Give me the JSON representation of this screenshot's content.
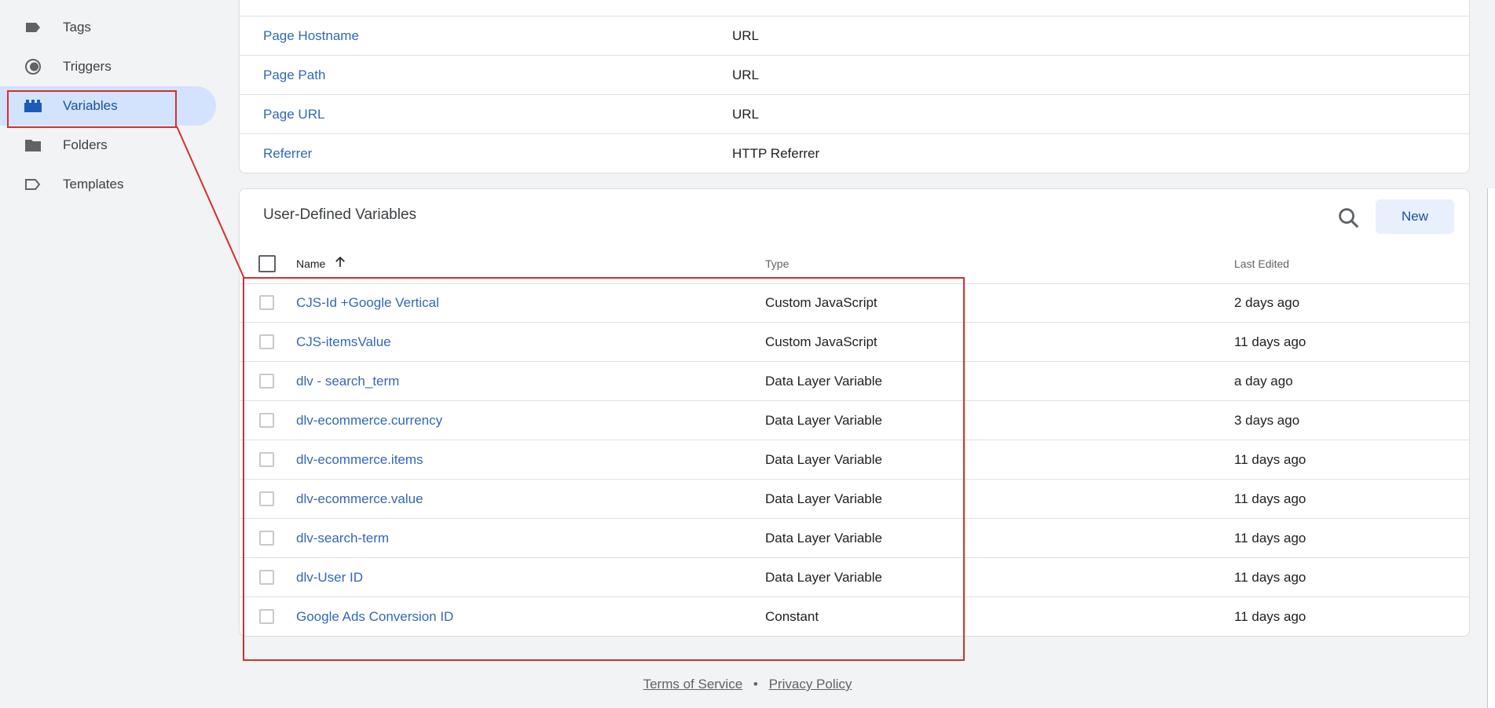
{
  "sidebar": {
    "items": [
      {
        "label": "Tags",
        "icon": "tag-icon"
      },
      {
        "label": "Triggers",
        "icon": "trigger-icon"
      },
      {
        "label": "Variables",
        "icon": "variables-icon",
        "active": true
      },
      {
        "label": "Folders",
        "icon": "folder-icon"
      },
      {
        "label": "Templates",
        "icon": "template-icon"
      }
    ]
  },
  "builtin": {
    "rows": [
      {
        "name": "Page Hostname",
        "type": "URL"
      },
      {
        "name": "Page Path",
        "type": "URL"
      },
      {
        "name": "Page URL",
        "type": "URL"
      },
      {
        "name": "Referrer",
        "type": "HTTP Referrer"
      }
    ]
  },
  "user_defined": {
    "title": "User-Defined Variables",
    "new_label": "New",
    "columns": {
      "name": "Name",
      "type": "Type",
      "last_edited": "Last Edited"
    },
    "rows": [
      {
        "name": "CJS-Id +Google Vertical",
        "type": "Custom JavaScript",
        "last_edited": "2 days ago"
      },
      {
        "name": "CJS-itemsValue",
        "type": "Custom JavaScript",
        "last_edited": "11 days ago"
      },
      {
        "name": "dlv - search_term",
        "type": "Data Layer Variable",
        "last_edited": "a day ago"
      },
      {
        "name": "dlv-ecommerce.currency",
        "type": "Data Layer Variable",
        "last_edited": "3 days ago"
      },
      {
        "name": "dlv-ecommerce.items",
        "type": "Data Layer Variable",
        "last_edited": "11 days ago"
      },
      {
        "name": "dlv-ecommerce.value",
        "type": "Data Layer Variable",
        "last_edited": "11 days ago"
      },
      {
        "name": "dlv-search-term",
        "type": "Data Layer Variable",
        "last_edited": "11 days ago"
      },
      {
        "name": "dlv-User ID",
        "type": "Data Layer Variable",
        "last_edited": "11 days ago"
      },
      {
        "name": "Google Ads Conversion ID",
        "type": "Constant",
        "last_edited": "11 days ago"
      }
    ]
  },
  "footer": {
    "terms": "Terms of Service",
    "separator": "•",
    "privacy": "Privacy Policy"
  },
  "colors": {
    "link": "#3367b8",
    "active_nav_bg": "#d3e3fd",
    "annotation": "#d32f2f",
    "new_button_bg": "#e8f0fe"
  }
}
